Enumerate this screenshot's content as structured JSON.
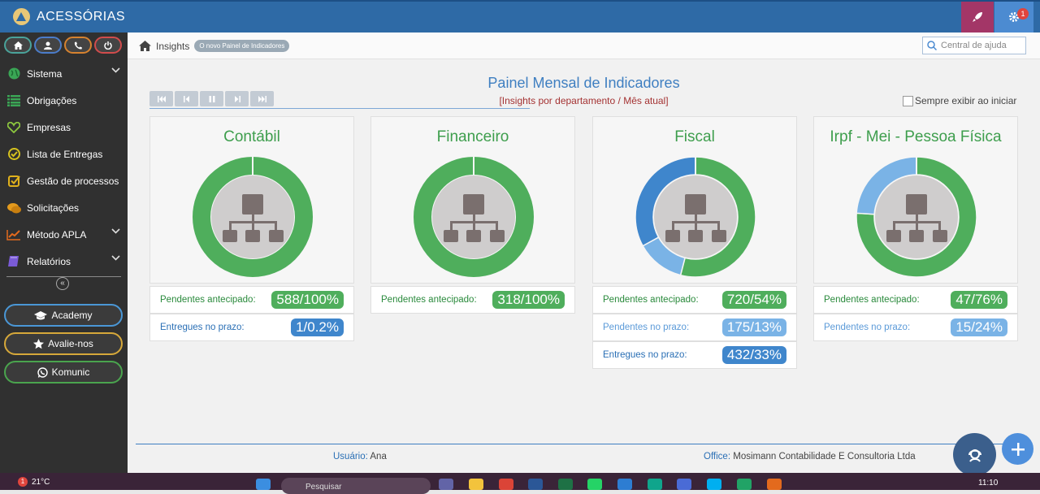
{
  "app": {
    "title": "ACESSÓRIAS",
    "notification_count": "1"
  },
  "sidebar": {
    "menu": [
      {
        "label": "Sistema",
        "icon": "globe-icon",
        "color": "#3aa655",
        "has_chevron": true
      },
      {
        "label": "Obrigações",
        "icon": "list-icon",
        "color": "#3aa655",
        "has_chevron": false
      },
      {
        "label": "Empresas",
        "icon": "heart-icon",
        "color": "#8cc63f",
        "has_chevron": false
      },
      {
        "label": "Lista de Entregas",
        "icon": "check-circle-icon",
        "color": "#d6c21e",
        "has_chevron": false
      },
      {
        "label": "Gestão de processos",
        "icon": "check-square-icon",
        "color": "#e0b11c",
        "has_chevron": false
      },
      {
        "label": "Solicitações",
        "icon": "chat-icon",
        "color": "#e39a1d",
        "has_chevron": false
      },
      {
        "label": "Método APLA",
        "icon": "chart-line-icon",
        "color": "#e36a1d",
        "has_chevron": true
      },
      {
        "label": "Relatórios",
        "icon": "book-icon",
        "color": "#7a5bd6",
        "has_chevron": true
      }
    ],
    "buttons": {
      "academy": "Academy",
      "rate": "Avalie-nos",
      "comm": "Komunic"
    }
  },
  "breadcrumb": {
    "label": "Insights",
    "badge": "O novo Painel de Indicadores"
  },
  "search": {
    "placeholder": "Central de ajuda"
  },
  "panel": {
    "title": "Painel Mensal de Indicadores",
    "subtitle": "[Insights por departamento / Mês atual]",
    "always_show": "Sempre exibir ao iniciar"
  },
  "colors": {
    "green": "#4fae5c",
    "blue": "#3f86cc",
    "light_blue": "#7ab3e6"
  },
  "cards": [
    {
      "title": "Contábil",
      "segments": [
        {
          "color": "green",
          "value": 1
        }
      ],
      "rows": [
        {
          "label": "Pendentes antecipado:",
          "value": "588/100%",
          "style": "g"
        },
        {
          "label": "Entregues no prazo:",
          "value": "1/0.2%",
          "style": "d"
        }
      ]
    },
    {
      "title": "Financeiro",
      "segments": [
        {
          "color": "green",
          "value": 1
        }
      ],
      "rows": [
        {
          "label": "Pendentes antecipado:",
          "value": "318/100%",
          "style": "g"
        }
      ]
    },
    {
      "title": "Fiscal",
      "segments": [
        {
          "color": "green",
          "value": 0.54
        },
        {
          "color": "light_blue",
          "value": 0.13
        },
        {
          "color": "blue",
          "value": 0.33
        }
      ],
      "rows": [
        {
          "label": "Pendentes antecipado:",
          "value": "720/54%",
          "style": "g"
        },
        {
          "label": "Pendentes no prazo:",
          "value": "175/13%",
          "style": "l"
        },
        {
          "label": "Entregues no prazo:",
          "value": "432/33%",
          "style": "d"
        }
      ]
    },
    {
      "title": "Irpf - Mei - Pessoa Física",
      "segments": [
        {
          "color": "green",
          "value": 0.76
        },
        {
          "color": "light_blue",
          "value": 0.24
        }
      ],
      "rows": [
        {
          "label": "Pendentes antecipado:",
          "value": "47/76%",
          "style": "g"
        },
        {
          "label": "Pendentes no prazo:",
          "value": "15/24%",
          "style": "l"
        }
      ]
    }
  ],
  "footer": {
    "user_key": "Usuário:",
    "user_value": "Ana",
    "office_key": "Office:",
    "office_value": "Mosimann Contabilidade E Consultoria Ltda"
  },
  "taskbar": {
    "weather": "21°C",
    "weather_badge": "1",
    "search": "Pesquisar",
    "time": "11:10"
  }
}
